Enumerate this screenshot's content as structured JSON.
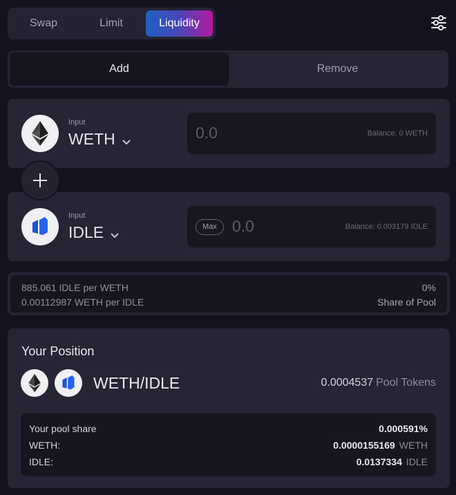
{
  "tabs": {
    "swap": "Swap",
    "limit": "Limit",
    "liquidity": "Liquidity",
    "active": "Liquidity"
  },
  "mode": {
    "add": "Add",
    "remove": "Remove",
    "active": "Add"
  },
  "token_a": {
    "label": "Input",
    "symbol": "WETH",
    "amount": "0.0",
    "balance": "Balance: 0 WETH",
    "icon": "ethereum-icon"
  },
  "token_b": {
    "label": "Input",
    "symbol": "IDLE",
    "amount": "0.0",
    "balance": "Balance: 0.003179 IDLE",
    "max_label": "Max",
    "icon": "idle-icon"
  },
  "rates": {
    "a_per_b": "885.061 IDLE per WETH",
    "b_per_a": "0.00112987 WETH per IDLE",
    "share": "0%",
    "share_label": "Share of Pool"
  },
  "position": {
    "title": "Your Position",
    "pair": "WETH/IDLE",
    "pool_tokens_value": "0.0004537",
    "pool_tokens_unit": "Pool Tokens",
    "pool_share_label": "Your pool share",
    "pool_share_value": "0.000591%",
    "weth_label": "WETH:",
    "weth_value": "0.0000155169",
    "weth_unit": "WETH",
    "idle_label": "IDLE:",
    "idle_value": "0.0137334",
    "idle_unit": "IDLE"
  },
  "colors": {
    "background": "#13131f",
    "panel": "#252536",
    "inset": "#16161f",
    "accent_start": "#1f5fbf",
    "accent_end": "#b41a9e",
    "idle_blue": "#1d54d6"
  }
}
